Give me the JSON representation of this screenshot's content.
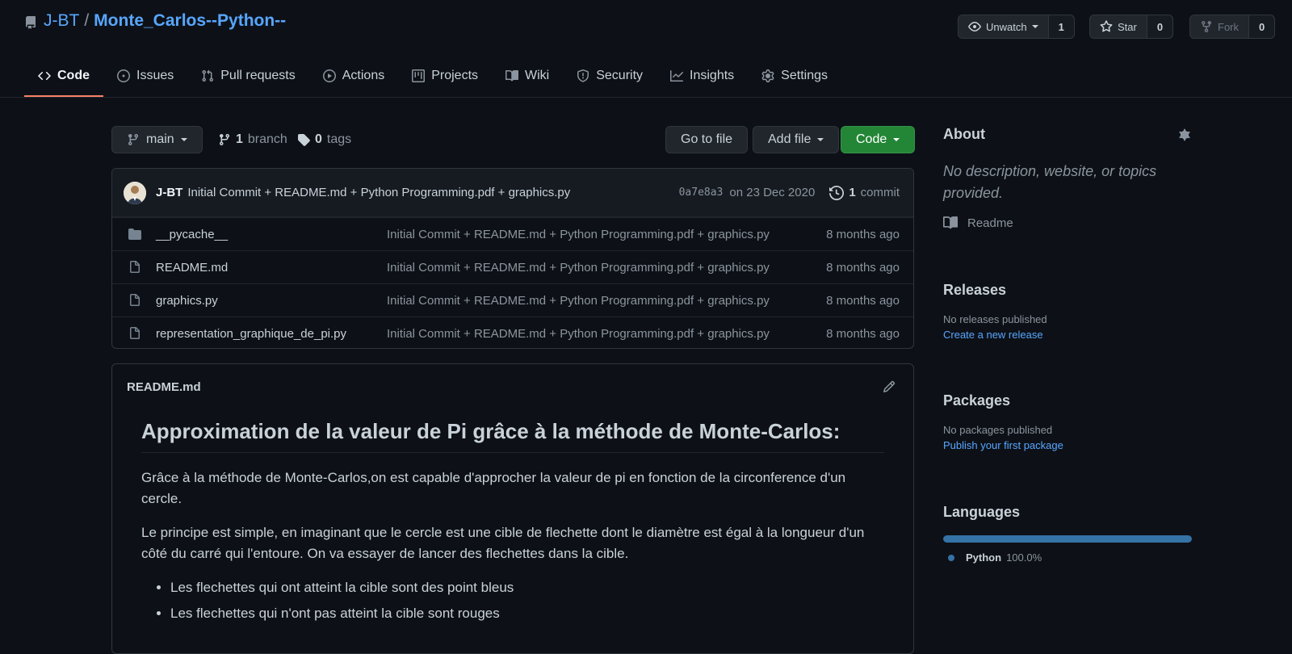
{
  "repo": {
    "owner": "J-BT",
    "slash": "/",
    "name": "Monte_Carlos--Python--"
  },
  "header_buttons": {
    "watch": {
      "label": "Unwatch",
      "count": "1"
    },
    "star": {
      "label": "Star",
      "count": "0"
    },
    "fork": {
      "label": "Fork",
      "count": "0"
    }
  },
  "tabs": [
    {
      "label": "Code",
      "icon": "code-icon",
      "active": true
    },
    {
      "label": "Issues",
      "icon": "issue-icon"
    },
    {
      "label": "Pull requests",
      "icon": "pull-request-icon"
    },
    {
      "label": "Actions",
      "icon": "play-icon"
    },
    {
      "label": "Projects",
      "icon": "project-icon"
    },
    {
      "label": "Wiki",
      "icon": "book-icon"
    },
    {
      "label": "Security",
      "icon": "shield-icon"
    },
    {
      "label": "Insights",
      "icon": "graph-icon"
    },
    {
      "label": "Settings",
      "icon": "gear-icon"
    }
  ],
  "branch_bar": {
    "branch": "main",
    "branch_count": "1",
    "branch_word": "branch",
    "tag_count": "0",
    "tag_word": "tags",
    "go_to_file": "Go to file",
    "add_file": "Add file",
    "code": "Code"
  },
  "commit": {
    "author": "J-BT",
    "message": "Initial Commit + README.md + Python Programming.pdf + graphics.py",
    "sha": "0a7e8a3",
    "date": "on 23 Dec 2020",
    "count": "1",
    "count_word": "commit"
  },
  "files": [
    {
      "name": "__pycache__",
      "type": "folder",
      "message": "Initial Commit + README.md + Python Programming.pdf + graphics.py",
      "age": "8 months ago"
    },
    {
      "name": "README.md",
      "type": "file",
      "message": "Initial Commit + README.md + Python Programming.pdf + graphics.py",
      "age": "8 months ago"
    },
    {
      "name": "graphics.py",
      "type": "file",
      "message": "Initial Commit + README.md + Python Programming.pdf + graphics.py",
      "age": "8 months ago"
    },
    {
      "name": "representation_graphique_de_pi.py",
      "type": "file",
      "message": "Initial Commit + README.md + Python Programming.pdf + graphics.py",
      "age": "8 months ago"
    }
  ],
  "readme": {
    "filename": "README.md",
    "title": "Approximation de la valeur de Pi grâce à la méthode de Monte-Carlos:",
    "p1": "Grâce à la méthode de Monte-Carlos,on est capable d'approcher la valeur de pi en fonction de la circonference d'un cercle.",
    "p2": "Le principe est simple, en imaginant que le cercle est une cible de flechette dont le diamètre est égal à la longueur d'un côté du carré qui l'entoure. On va essayer de lancer des flechettes dans la cible.",
    "bullets": [
      "Les flechettes qui ont atteint la cible sont des point bleus",
      "Les flechettes qui n'ont pas atteint la cible sont rouges"
    ]
  },
  "sidebar": {
    "about_title": "About",
    "about_desc": "No description, website, or topics provided.",
    "readme_link": "Readme",
    "releases_title": "Releases",
    "releases_none": "No releases published",
    "releases_create": "Create a new release",
    "packages_title": "Packages",
    "packages_none": "No packages published",
    "packages_publish": "Publish your first package",
    "languages_title": "Languages",
    "language": {
      "name": "Python",
      "percent": "100.0%",
      "fraction": 1.0,
      "color": "#3572A5"
    }
  },
  "colors": {
    "accent": "#58a6ff",
    "green": "#238636",
    "tab_underline": "#f78166"
  }
}
